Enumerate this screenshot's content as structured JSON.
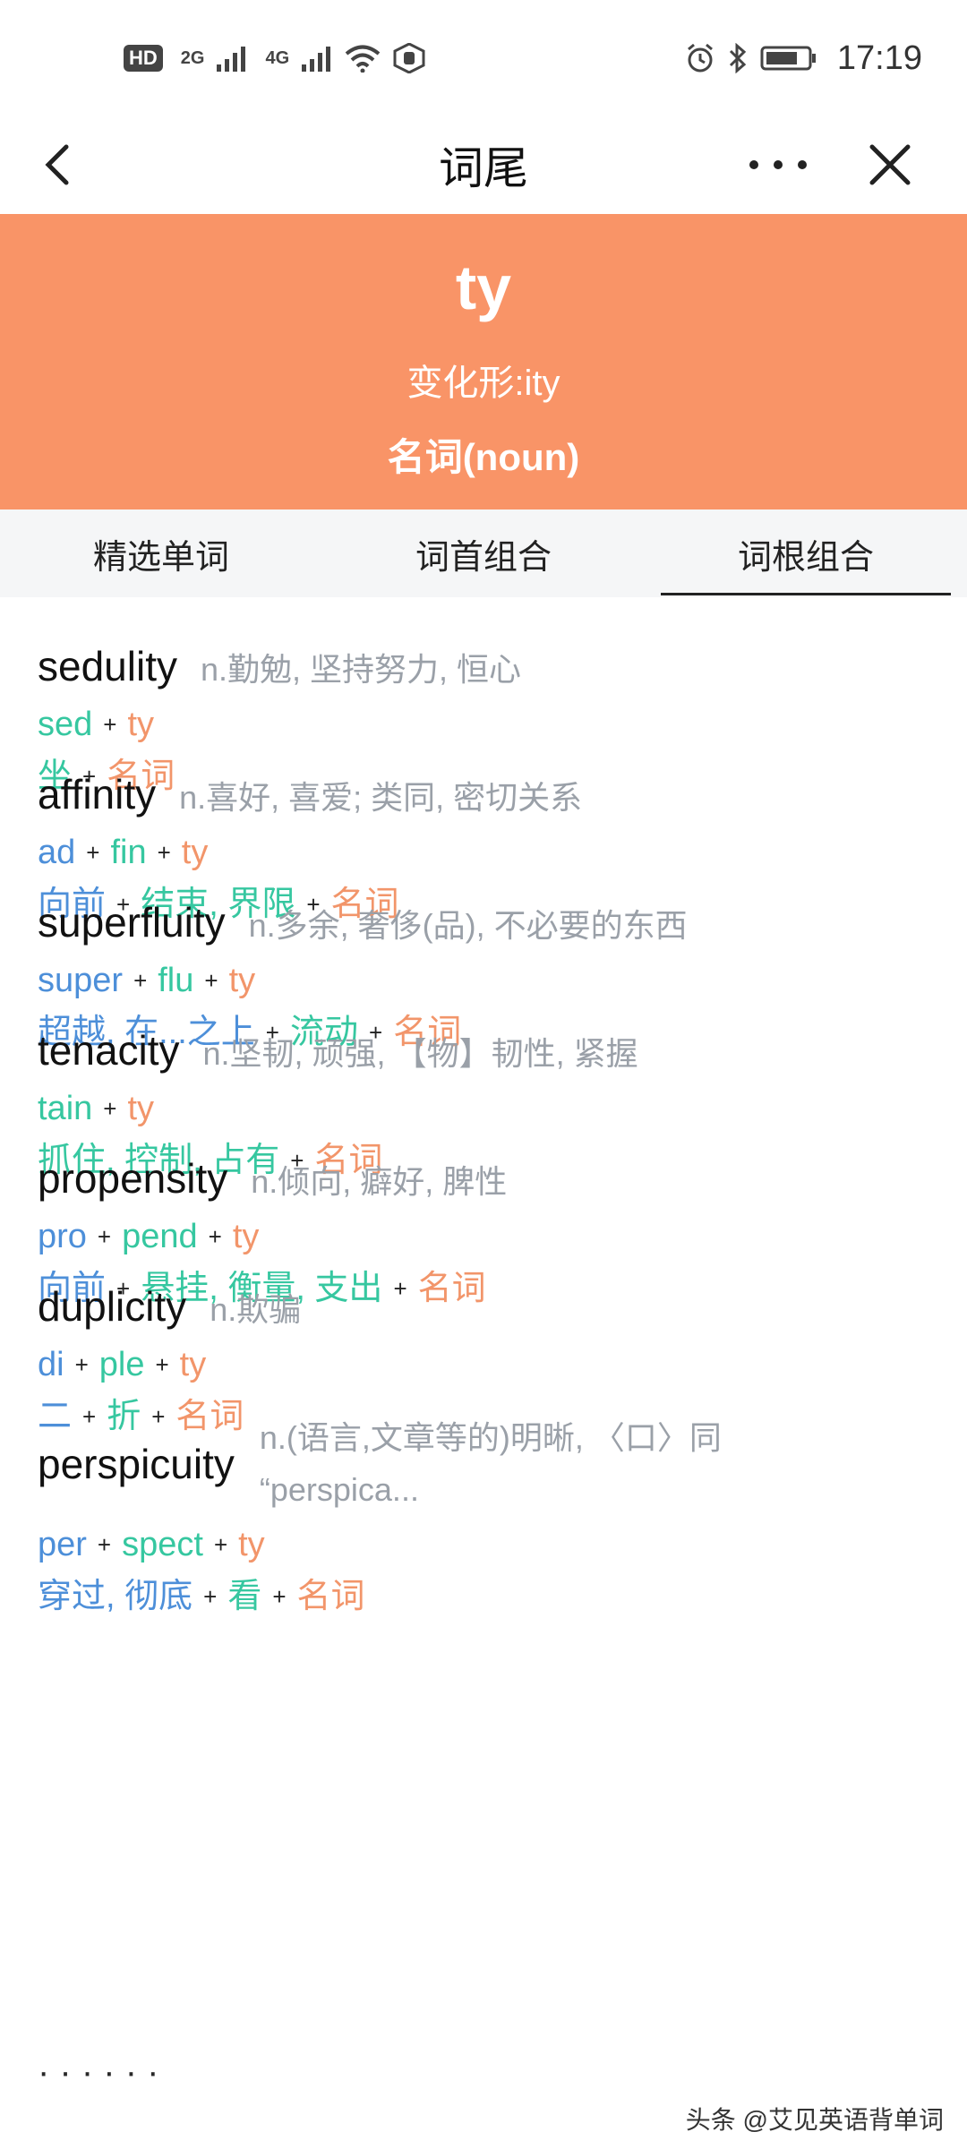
{
  "status_bar": {
    "badge": "HD",
    "sim1": "2G",
    "sim2": "4G",
    "time": "17:19"
  },
  "nav": {
    "title": "词尾",
    "icons": [
      "back-icon",
      "more-icon",
      "close-icon"
    ]
  },
  "header": {
    "word": "ty",
    "variant": "变化形:ity",
    "pos": "名词(noun)",
    "bg_color": "#f99467"
  },
  "tabs": [
    {
      "label": "精选单词",
      "active": false
    },
    {
      "label": "词首组合",
      "active": false
    },
    {
      "label": "词根组合",
      "active": true
    }
  ],
  "colors": {
    "prefix": "#4d8fd9",
    "root": "#36c7a0",
    "suffix": "#f2956a",
    "meaning": "#9aa0a8"
  },
  "entries": [
    {
      "word": "sedulity",
      "meaning": "n.勤勉, 坚持努力, 恒心",
      "parts": [
        {
          "text": "sed",
          "type": "root"
        },
        {
          "text": "ty",
          "type": "suffix"
        }
      ],
      "glosses": [
        {
          "text": "坐",
          "type": "root"
        },
        {
          "text": "名词",
          "type": "suffix"
        }
      ]
    },
    {
      "word": "affinity",
      "meaning": "n.喜好, 喜爱; 类同, 密切关系",
      "parts": [
        {
          "text": "ad",
          "type": "prefix"
        },
        {
          "text": "fin",
          "type": "root"
        },
        {
          "text": "ty",
          "type": "suffix"
        }
      ],
      "glosses": [
        {
          "text": "向前",
          "type": "prefix"
        },
        {
          "text": "结束, 界限",
          "type": "root"
        },
        {
          "text": "名词",
          "type": "suffix"
        }
      ]
    },
    {
      "word": "superfluity",
      "meaning": "n.多余, 奢侈(品), 不必要的东西",
      "parts": [
        {
          "text": "super",
          "type": "prefix"
        },
        {
          "text": "flu",
          "type": "root"
        },
        {
          "text": "ty",
          "type": "suffix"
        }
      ],
      "glosses": [
        {
          "text": "超越, 在...之上",
          "type": "prefix"
        },
        {
          "text": "流动",
          "type": "root"
        },
        {
          "text": "名词",
          "type": "suffix"
        }
      ]
    },
    {
      "word": "tenacity",
      "meaning": "n.坚韧, 顽强, 【物】韧性, 紧握",
      "parts": [
        {
          "text": "tain",
          "type": "root"
        },
        {
          "text": "ty",
          "type": "suffix"
        }
      ],
      "glosses": [
        {
          "text": "抓住, 控制, 占有",
          "type": "root"
        },
        {
          "text": "名词",
          "type": "suffix"
        }
      ]
    },
    {
      "word": "propensity",
      "meaning": "n.倾向, 癖好, 脾性",
      "parts": [
        {
          "text": "pro",
          "type": "prefix"
        },
        {
          "text": "pend",
          "type": "root"
        },
        {
          "text": "ty",
          "type": "suffix"
        }
      ],
      "glosses": [
        {
          "text": "向前",
          "type": "prefix"
        },
        {
          "text": "悬挂, 衡量, 支出",
          "type": "root"
        },
        {
          "text": "名词",
          "type": "suffix"
        }
      ]
    },
    {
      "word": "duplicity",
      "meaning": "n.欺骗",
      "parts": [
        {
          "text": "di",
          "type": "prefix"
        },
        {
          "text": "ple",
          "type": "root"
        },
        {
          "text": "ty",
          "type": "suffix"
        }
      ],
      "glosses": [
        {
          "text": "二",
          "type": "prefix"
        },
        {
          "text": "折",
          "type": "root"
        },
        {
          "text": "名词",
          "type": "suffix"
        }
      ]
    },
    {
      "word": "perspicuity",
      "meaning": "n.(语言,文章等的)明晰, 〈口〉同 “perspica...",
      "parts": [
        {
          "text": "per",
          "type": "prefix"
        },
        {
          "text": "spect",
          "type": "root"
        },
        {
          "text": "ty",
          "type": "suffix"
        }
      ],
      "glosses": [
        {
          "text": "穿过, 彻底",
          "type": "prefix"
        },
        {
          "text": "看",
          "type": "root"
        },
        {
          "text": "名词",
          "type": "suffix"
        }
      ]
    }
  ],
  "watermark": "头条 @艾见英语背单词"
}
